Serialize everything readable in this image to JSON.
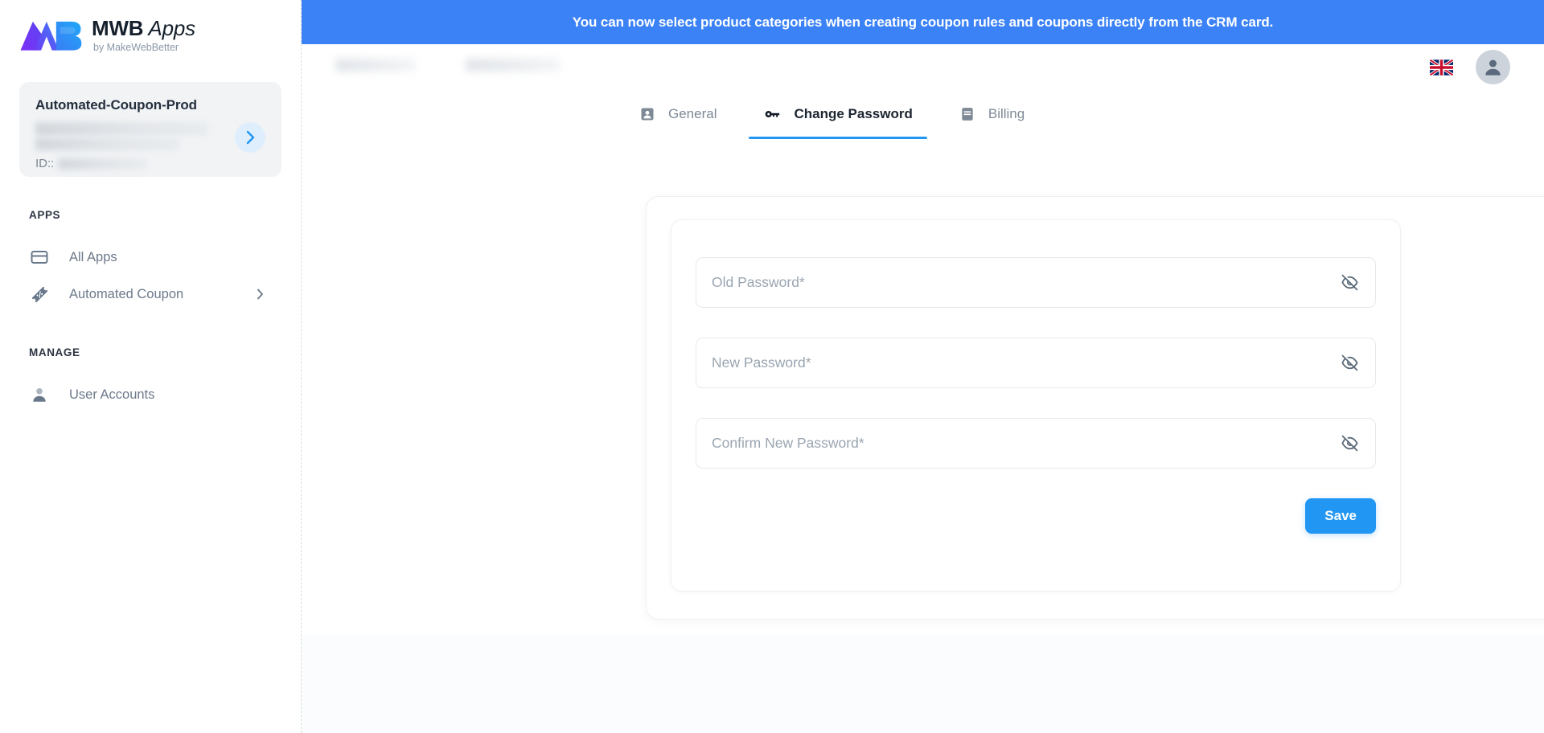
{
  "brand": {
    "title_strong": "MWB",
    "title_light": " Apps",
    "subtitle": "by MakeWebBetter",
    "logo_icon": "mwb-logo-icon"
  },
  "account_card": {
    "name": "Automated-Coupon-Prod",
    "id_label": "ID::",
    "arrow_icon": "chevron-right-icon",
    "masked_email": "",
    "masked_id": ""
  },
  "sidebar": {
    "sections": [
      {
        "heading": "APPS",
        "items": [
          {
            "label": "All Apps",
            "icon": "card-icon",
            "has_chevron": false
          },
          {
            "label": "Automated Coupon",
            "icon": "coupon-percent-icon",
            "has_chevron": true
          }
        ]
      },
      {
        "heading": "MANAGE",
        "items": [
          {
            "label": "User Accounts",
            "icon": "user-icon",
            "has_chevron": false
          }
        ]
      }
    ]
  },
  "banner": {
    "message": "You can now select product categories when creating coupon rules and coupons directly from the CRM card.",
    "background": "#3b82f6",
    "text_color": "#ffffff"
  },
  "topbar": {
    "language_flag": "uk-flag-icon",
    "avatar_icon": "user-avatar-icon"
  },
  "tabs": [
    {
      "label": "General",
      "icon": "person-card-icon",
      "active": false
    },
    {
      "label": "Change Password",
      "icon": "key-icon",
      "active": true
    },
    {
      "label": "Billing",
      "icon": "invoice-icon",
      "active": false
    }
  ],
  "form": {
    "fields": [
      {
        "placeholder": "Old Password*",
        "value": "",
        "toggle_icon": "eye-off-icon"
      },
      {
        "placeholder": "New Password*",
        "value": "",
        "toggle_icon": "eye-off-icon"
      },
      {
        "placeholder": "Confirm New Password*",
        "value": "",
        "toggle_icon": "eye-off-icon"
      }
    ],
    "save_label": "Save"
  },
  "colors": {
    "accent": "#2196f3",
    "banner": "#3b82f6",
    "sidebar_text": "#6d7a8a",
    "heading": "#2c3542"
  }
}
